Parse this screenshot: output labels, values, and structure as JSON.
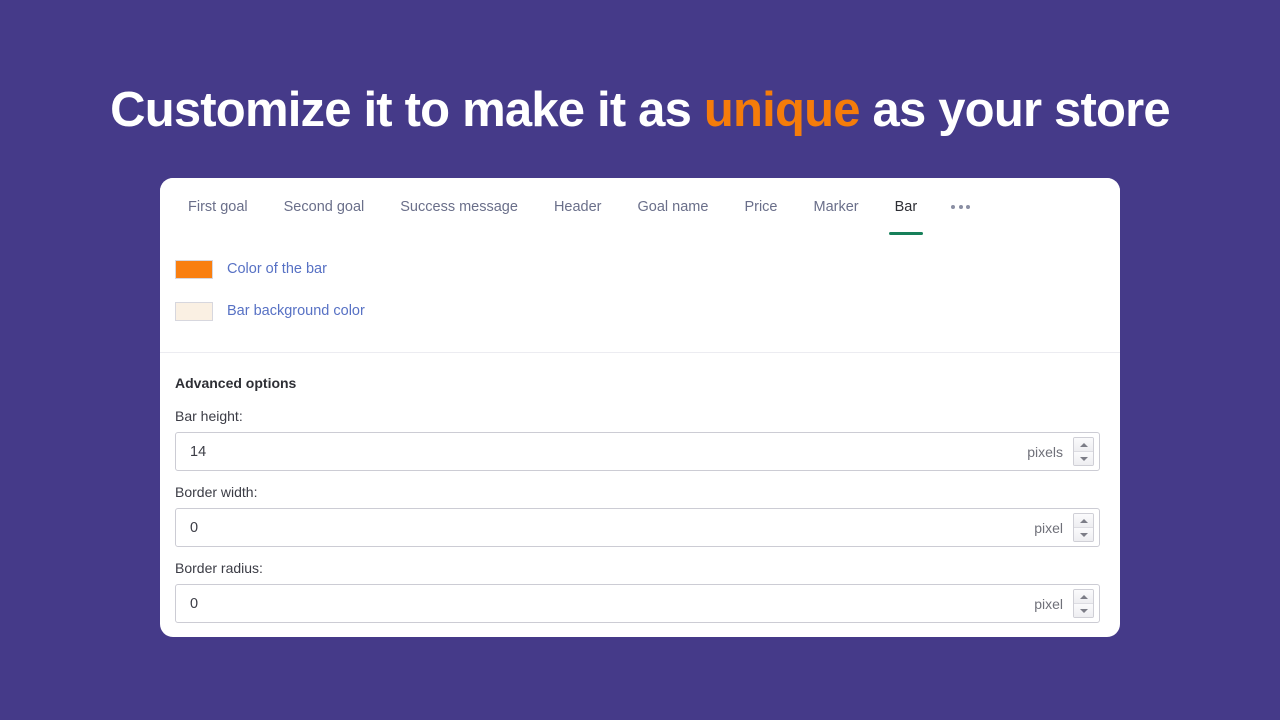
{
  "page": {
    "background_color": "#453A89",
    "headline_prefix": "Customize it to make it as ",
    "headline_accent": "unique",
    "headline_suffix": " as your store",
    "accent_color": "#F57C0A"
  },
  "card": {
    "tabs": [
      {
        "label": "First goal",
        "active": false
      },
      {
        "label": "Second goal",
        "active": false
      },
      {
        "label": "Success message",
        "active": false
      },
      {
        "label": "Header",
        "active": false
      },
      {
        "label": "Goal name",
        "active": false
      },
      {
        "label": "Price",
        "active": false
      },
      {
        "label": "Marker",
        "active": false
      },
      {
        "label": "Bar",
        "active": true
      }
    ],
    "overflow_icon": "ellipsis-icon",
    "active_tab_indicator_color": "#17805A",
    "colors": [
      {
        "label": "Color of the bar",
        "swatch": "#F97F10"
      },
      {
        "label": "Bar background color",
        "swatch": "#FAF0E3"
      }
    ],
    "advanced": {
      "title": "Advanced options",
      "fields": [
        {
          "label": "Bar height:",
          "value": "14",
          "unit": "pixels"
        },
        {
          "label": "Border width:",
          "value": "0",
          "unit": "pixel"
        },
        {
          "label": "Border radius:",
          "value": "0",
          "unit": "pixel"
        }
      ]
    }
  }
}
